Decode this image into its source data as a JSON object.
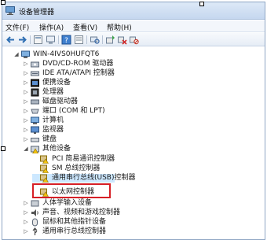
{
  "window": {
    "title": "设备管理器",
    "title_icon": "device-manager-icon"
  },
  "menu": [
    {
      "label": "文件(F)"
    },
    {
      "label": "操作(A)"
    },
    {
      "label": "查看(V)"
    },
    {
      "label": "帮助(H)"
    }
  ],
  "toolbar": [
    {
      "icon": "back-arrow-icon"
    },
    {
      "icon": "forward-arrow-icon"
    },
    {
      "icon": "properties-icon"
    },
    {
      "icon": "computer-view-icon"
    },
    {
      "icon": "help-icon"
    },
    {
      "icon": "show-hidden-icon"
    },
    {
      "icon": "scan-hardware-icon"
    },
    {
      "icon": "update-driver-icon"
    },
    {
      "icon": "uninstall-icon"
    },
    {
      "icon": "disable-device-icon"
    }
  ],
  "tree": {
    "root": "WIN-4IVS0HUFQT6",
    "items": [
      {
        "label": "DVD/CD-ROM 驱动器",
        "icon": "dvd-drive-icon"
      },
      {
        "label": "IDE ATA/ATAPI 控制器",
        "icon": "ide-controller-icon"
      },
      {
        "label": "便携设备",
        "icon": "portable-device-icon"
      },
      {
        "label": "处理器",
        "icon": "processor-icon"
      },
      {
        "label": "磁盘驱动器",
        "icon": "disk-drive-icon"
      },
      {
        "label": "端口 (COM 和 LPT)",
        "icon": "port-icon"
      },
      {
        "label": "计算机",
        "icon": "computer-icon"
      },
      {
        "label": "监视器",
        "icon": "monitor-icon"
      },
      {
        "label": "键盘",
        "icon": "keyboard-icon"
      },
      {
        "label": "其他设备",
        "icon": "other-devices-icon",
        "expanded": true
      },
      {
        "label": "PCI 简易通讯控制器",
        "icon": "warning-device-icon",
        "child": true
      },
      {
        "label": "SM 总线控制器",
        "icon": "warning-device-icon",
        "child": true
      },
      {
        "label": "通用串行总线(USB)控制器",
        "icon": "warning-device-icon",
        "child": true,
        "selected": true
      },
      {
        "label": "以太网控制器",
        "icon": "warning-device-icon",
        "child": true,
        "highlighted": true
      },
      {
        "label": "人体学输入设备",
        "icon": "hid-icon"
      },
      {
        "label": "声音、视频和游戏控制器",
        "icon": "sound-icon"
      },
      {
        "label": "鼠标和其他指针设备",
        "icon": "mouse-icon"
      },
      {
        "label": "通用串行总线控制器",
        "icon": "usb-icon"
      }
    ]
  },
  "colors": {
    "highlight_border": "#d61f26",
    "selection": "#cde8ff",
    "titlebar": "#c5d7ef"
  }
}
